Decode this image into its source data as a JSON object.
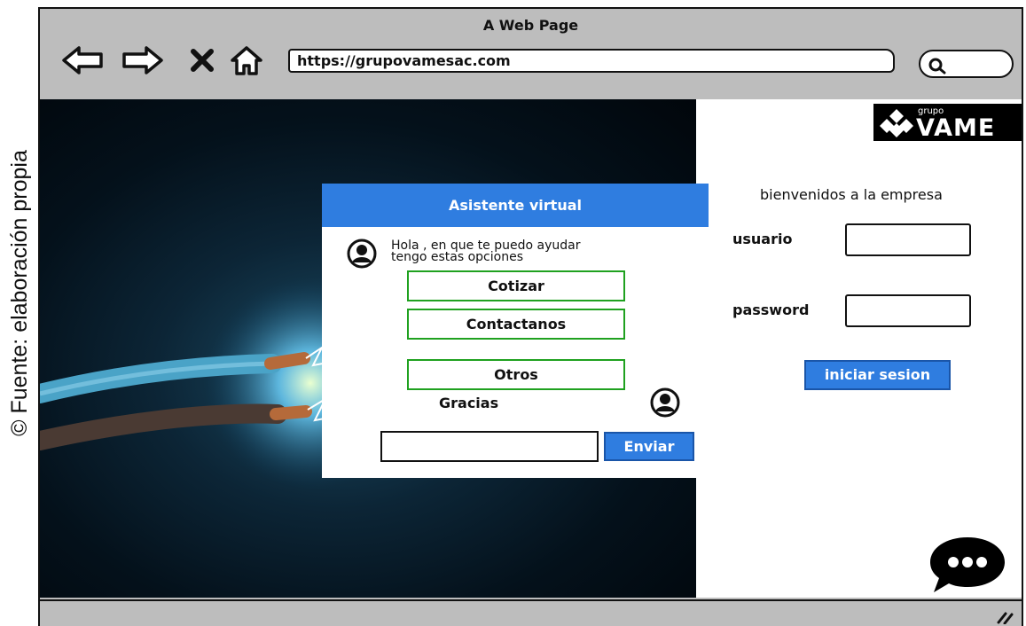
{
  "credit": "© Fuente: elaboración propia",
  "window": {
    "title": "A Web Page"
  },
  "toolbar": {
    "url": "https://grupovamesac.com",
    "icons": [
      "back-arrow-icon",
      "forward-arrow-icon",
      "close-x-icon",
      "home-icon",
      "search-icon"
    ]
  },
  "logo": {
    "small_text": "grupo",
    "big_text": "VAME"
  },
  "login": {
    "welcome": "bienvenidos a la empresa",
    "user_label": "usuario",
    "password_label": "password",
    "submit_label": "iniciar sesion"
  },
  "chat": {
    "title": "Asistente virtual",
    "bot_message_line1": "Hola , en que te puedo ayudar",
    "bot_message_line2": "tengo estas opciones",
    "options": [
      "Cotizar",
      "Contactanos",
      "Otros"
    ],
    "user_message": "Gracias",
    "input_value": "",
    "send_label": "Enviar"
  },
  "colors": {
    "accent": "#2f7de0",
    "option_border": "#1fa11f",
    "chrome": "#bdbdbd"
  }
}
